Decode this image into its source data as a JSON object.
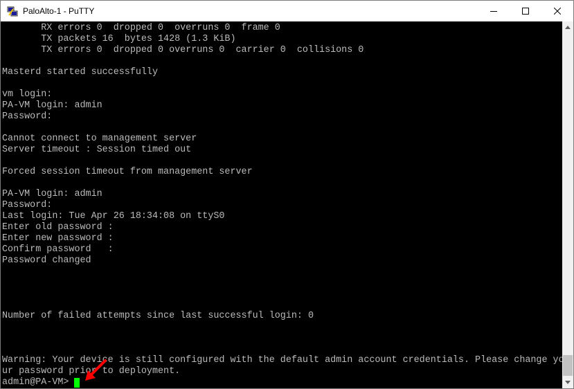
{
  "window": {
    "title": "PaloAlto-1 - PuTTY",
    "controls": {
      "minimize": "—",
      "maximize": "☐",
      "close": "✕"
    },
    "app_icon": "putty-icon"
  },
  "terminal": {
    "lines": [
      "       RX errors 0  dropped 0  overruns 0  frame 0",
      "       TX packets 16  bytes 1428 (1.3 KiB)",
      "       TX errors 0  dropped 0 overruns 0  carrier 0  collisions 0",
      "",
      "Masterd started successfully",
      "",
      "vm login:",
      "PA-VM login: admin",
      "Password:",
      "",
      "Cannot connect to management server",
      "Server timeout : Session timed out",
      "",
      "Forced session timeout from management server",
      "",
      "PA-VM login: admin",
      "Password:",
      "Last login: Tue Apr 26 18:34:08 on ttyS0",
      "Enter old password :",
      "Enter new password :",
      "Confirm password   :",
      "Password changed",
      "",
      "",
      "",
      "",
      "Number of failed attempts since last successful login: 0",
      "",
      "",
      "",
      "Warning: Your device is still configured with the default admin account credentials. Please change yo",
      "ur password prior to deployment.",
      "admin@PA-VM> "
    ],
    "text_color": "#bbbbbb",
    "background": "#000000",
    "cursor_color": "#00ff00"
  },
  "annotation": {
    "arrow_color": "#ff0000",
    "icon": "red-arrow-icon"
  }
}
